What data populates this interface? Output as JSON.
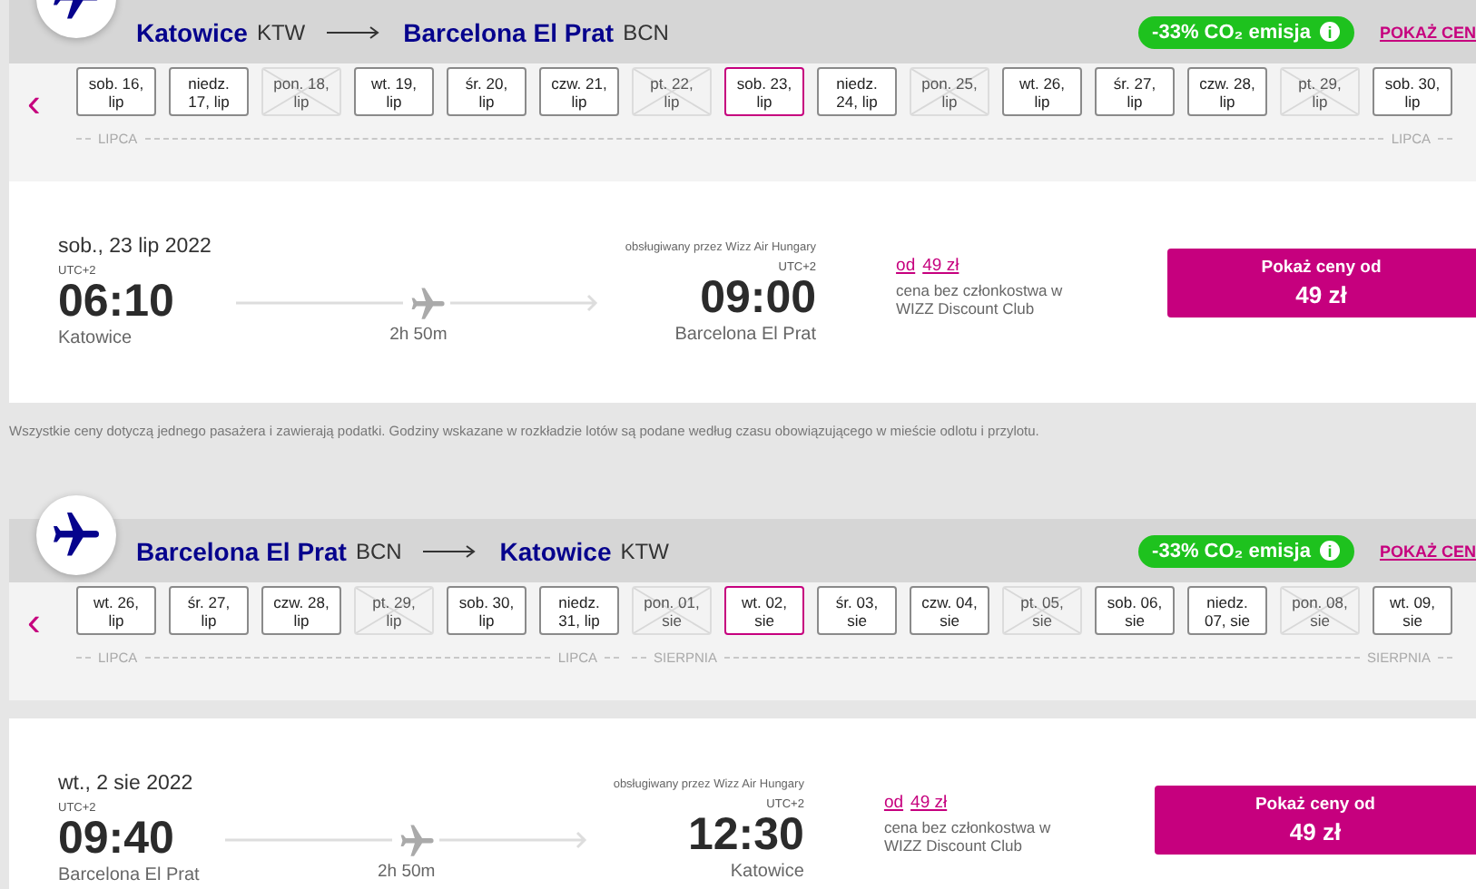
{
  "journeys": [
    {
      "from_city": "Katowice",
      "from_code": "KTW",
      "to_city": "Barcelona El Prat",
      "to_code": "BCN",
      "co2_badge": "-33% CO₂ emisja",
      "info_icon": "i",
      "show_prices_link": "POKAŻ CEN",
      "prev_arrow": "‹",
      "months": [
        {
          "start_label": "LIPCA",
          "end_label": "LIPCA",
          "dates": [
            {
              "lines": [
                "sob. 16,",
                "lip"
              ],
              "kind": "available",
              "selected": false
            },
            {
              "lines": [
                "niedz.",
                "17, lip"
              ],
              "kind": "available",
              "selected": false
            },
            {
              "lines": [
                "pon. 18,",
                "lip"
              ],
              "kind": "unavailable",
              "selected": false
            },
            {
              "lines": [
                "wt. 19,",
                "lip"
              ],
              "kind": "available",
              "selected": false
            },
            {
              "lines": [
                "śr. 20,",
                "lip"
              ],
              "kind": "available",
              "selected": false
            },
            {
              "lines": [
                "czw. 21,",
                "lip"
              ],
              "kind": "available",
              "selected": false
            },
            {
              "lines": [
                "pt. 22,",
                "lip"
              ],
              "kind": "unavailable",
              "selected": false
            },
            {
              "lines": [
                "sob. 23,",
                "lip"
              ],
              "kind": "available",
              "selected": true
            },
            {
              "lines": [
                "niedz.",
                "24, lip"
              ],
              "kind": "available",
              "selected": false
            },
            {
              "lines": [
                "pon. 25,",
                "lip"
              ],
              "kind": "unavailable",
              "selected": false
            },
            {
              "lines": [
                "wt. 26,",
                "lip"
              ],
              "kind": "available",
              "selected": false
            },
            {
              "lines": [
                "śr. 27,",
                "lip"
              ],
              "kind": "available",
              "selected": false
            },
            {
              "lines": [
                "czw. 28,",
                "lip"
              ],
              "kind": "available",
              "selected": false
            },
            {
              "lines": [
                "pt. 29,",
                "lip"
              ],
              "kind": "unavailable",
              "selected": false
            },
            {
              "lines": [
                "sob. 30,",
                "lip"
              ],
              "kind": "available",
              "selected": false
            }
          ]
        }
      ],
      "flight": {
        "date": "sob., 23 lip 2022",
        "operator": "obsługiwany przez Wizz Air Hungary",
        "dep_tz": "UTC+2",
        "dep_time": "06:10",
        "dep_city": "Katowice",
        "duration": "2h 50m",
        "arr_tz": "UTC+2",
        "arr_time": "09:00",
        "arr_city": "Barcelona El Prat",
        "from_label": "od",
        "from_price": "49 zł",
        "price_note": "cena bez członkostwa w WIZZ Discount Club",
        "button_label": "Pokaż ceny od",
        "button_price": "49 zł"
      }
    },
    {
      "from_city": "Barcelona El Prat",
      "from_code": "BCN",
      "to_city": "Katowice",
      "to_code": "KTW",
      "co2_badge": "-33% CO₂ emisja",
      "info_icon": "i",
      "show_prices_link": "POKAŻ CEN",
      "prev_arrow": "‹",
      "months": [
        {
          "start_label": "LIPCA",
          "end_label": "LIPCA",
          "dates": [
            {
              "lines": [
                "wt. 26,",
                "lip"
              ],
              "kind": "available",
              "selected": false
            },
            {
              "lines": [
                "śr. 27,",
                "lip"
              ],
              "kind": "available",
              "selected": false
            },
            {
              "lines": [
                "czw. 28,",
                "lip"
              ],
              "kind": "available",
              "selected": false
            },
            {
              "lines": [
                "pt. 29,",
                "lip"
              ],
              "kind": "unavailable",
              "selected": false
            },
            {
              "lines": [
                "sob. 30,",
                "lip"
              ],
              "kind": "available",
              "selected": false
            },
            {
              "lines": [
                "niedz.",
                "31, lip"
              ],
              "kind": "available",
              "selected": false
            }
          ]
        },
        {
          "start_label": "SIERPNIA",
          "end_label": "SIERPNIA",
          "dates": [
            {
              "lines": [
                "pon. 01,",
                "sie"
              ],
              "kind": "unavailable",
              "selected": false
            },
            {
              "lines": [
                "wt. 02,",
                "sie"
              ],
              "kind": "available",
              "selected": true
            },
            {
              "lines": [
                "śr. 03,",
                "sie"
              ],
              "kind": "available",
              "selected": false
            },
            {
              "lines": [
                "czw. 04,",
                "sie"
              ],
              "kind": "available",
              "selected": false
            },
            {
              "lines": [
                "pt. 05,",
                "sie"
              ],
              "kind": "unavailable",
              "selected": false
            },
            {
              "lines": [
                "sob. 06,",
                "sie"
              ],
              "kind": "available",
              "selected": false
            },
            {
              "lines": [
                "niedz.",
                "07, sie"
              ],
              "kind": "available",
              "selected": false
            },
            {
              "lines": [
                "pon. 08,",
                "sie"
              ],
              "kind": "unavailable",
              "selected": false
            },
            {
              "lines": [
                "wt. 09,",
                "sie"
              ],
              "kind": "available",
              "selected": false
            }
          ]
        }
      ],
      "flight": {
        "date": "wt., 2 sie 2022",
        "operator": "obsługiwany przez Wizz Air Hungary",
        "dep_tz": "UTC+2",
        "dep_time": "09:40",
        "dep_city": "Barcelona El Prat",
        "duration": "2h 50m",
        "arr_tz": "UTC+2",
        "arr_time": "12:30",
        "arr_city": "Katowice",
        "from_label": "od",
        "from_price": "49 zł",
        "price_note": "cena bez członkostwa w WIZZ Discount Club",
        "button_label": "Pokaż ceny od",
        "button_price": "49 zł"
      }
    }
  ],
  "note": "Wszystkie ceny dotyczą jednego pasażera i zawierają podatki. Godziny wskazane w rozkładzie lotów są podane według czasu obowiązującego w mieście odlotu i przylotu."
}
